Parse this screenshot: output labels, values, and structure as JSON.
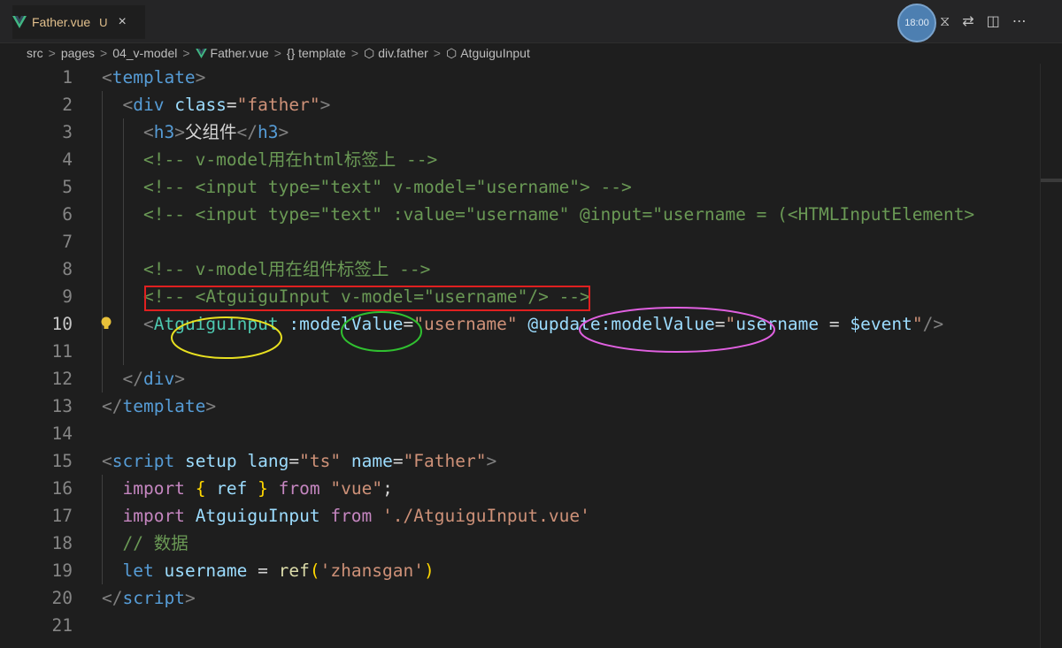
{
  "tab": {
    "label": "Father.vue",
    "status": "U",
    "close": "×"
  },
  "timer": {
    "label": "18:00"
  },
  "breadcrumb": [
    "src",
    "pages",
    "04_v-model",
    "Father.vue",
    "{} template",
    "div.father",
    "AtguiguInput"
  ],
  "editor": {
    "active_line": 10
  },
  "lines": [
    {
      "n": "1",
      "segs": [
        [
          "tag",
          "<"
        ],
        [
          "tn",
          "template"
        ],
        [
          "tag",
          ">"
        ]
      ]
    },
    {
      "n": "2",
      "segs": [
        [
          "txt",
          "  "
        ],
        [
          "tag",
          "<"
        ],
        [
          "tn",
          "div"
        ],
        [
          "txt",
          " "
        ],
        [
          "attr",
          "class"
        ],
        [
          "txt",
          "="
        ],
        [
          "str",
          "\"father\""
        ],
        [
          "tag",
          ">"
        ]
      ]
    },
    {
      "n": "3",
      "segs": [
        [
          "txt",
          "    "
        ],
        [
          "tag",
          "<"
        ],
        [
          "tn",
          "h3"
        ],
        [
          "tag",
          ">"
        ],
        [
          "txt",
          "父组件"
        ],
        [
          "tag",
          "</"
        ],
        [
          "tn",
          "h3"
        ],
        [
          "tag",
          ">"
        ]
      ]
    },
    {
      "n": "4",
      "segs": [
        [
          "txt",
          "    "
        ],
        [
          "com",
          "<!-- v-model用在html标签上 -->"
        ]
      ]
    },
    {
      "n": "5",
      "segs": [
        [
          "txt",
          "    "
        ],
        [
          "com",
          "<!-- <input type=\"text\" v-model=\"username\"> -->"
        ]
      ]
    },
    {
      "n": "6",
      "segs": [
        [
          "txt",
          "    "
        ],
        [
          "com",
          "<!-- <input type=\"text\" :value=\"username\" @input=\"username = (<HTMLInputElement>"
        ]
      ]
    },
    {
      "n": "7",
      "segs": []
    },
    {
      "n": "8",
      "segs": [
        [
          "txt",
          "    "
        ],
        [
          "com",
          "<!-- v-model用在组件标签上 -->"
        ]
      ]
    },
    {
      "n": "9",
      "segs": [
        [
          "txt",
          "    "
        ],
        [
          "com",
          "<!-- <AtguiguInput v-model=\"username\"/> -->"
        ]
      ]
    },
    {
      "n": "10",
      "segs": [
        [
          "txt",
          "    "
        ],
        [
          "tag",
          "<"
        ],
        [
          "comp",
          "AtguiguInput"
        ],
        [
          "txt",
          " "
        ],
        [
          "attr",
          ":modelValue"
        ],
        [
          "txt",
          "="
        ],
        [
          "str",
          "\"username\""
        ],
        [
          "txt",
          " "
        ],
        [
          "attr",
          "@update:modelValue"
        ],
        [
          "txt",
          "="
        ],
        [
          "str",
          "\""
        ],
        [
          "attr",
          "username"
        ],
        [
          "txt",
          " = "
        ],
        [
          "attr",
          "$event"
        ],
        [
          "str",
          "\""
        ],
        [
          "tag",
          "/>"
        ]
      ]
    },
    {
      "n": "11",
      "segs": []
    },
    {
      "n": "12",
      "segs": [
        [
          "txt",
          "  "
        ],
        [
          "tag",
          "</"
        ],
        [
          "tn",
          "div"
        ],
        [
          "tag",
          ">"
        ]
      ]
    },
    {
      "n": "13",
      "segs": [
        [
          "tag",
          "</"
        ],
        [
          "tn",
          "template"
        ],
        [
          "tag",
          ">"
        ]
      ]
    },
    {
      "n": "14",
      "segs": []
    },
    {
      "n": "15",
      "segs": [
        [
          "tag",
          "<"
        ],
        [
          "tn",
          "script"
        ],
        [
          "txt",
          " "
        ],
        [
          "attr",
          "setup"
        ],
        [
          "txt",
          " "
        ],
        [
          "attr",
          "lang"
        ],
        [
          "txt",
          "="
        ],
        [
          "str",
          "\"ts\""
        ],
        [
          "txt",
          " "
        ],
        [
          "attr",
          "name"
        ],
        [
          "txt",
          "="
        ],
        [
          "str",
          "\"Father\""
        ],
        [
          "tag",
          ">"
        ]
      ]
    },
    {
      "n": "16",
      "segs": [
        [
          "txt",
          "  "
        ],
        [
          "kw",
          "import"
        ],
        [
          "txt",
          " "
        ],
        [
          "br",
          "{"
        ],
        [
          "txt",
          " "
        ],
        [
          "attr",
          "ref"
        ],
        [
          "txt",
          " "
        ],
        [
          "br",
          "}"
        ],
        [
          "txt",
          " "
        ],
        [
          "kw",
          "from"
        ],
        [
          "txt",
          " "
        ],
        [
          "str",
          "\"vue\""
        ],
        [
          "txt",
          ";"
        ]
      ]
    },
    {
      "n": "17",
      "segs": [
        [
          "txt",
          "  "
        ],
        [
          "kw",
          "import"
        ],
        [
          "txt",
          " "
        ],
        [
          "attr",
          "AtguiguInput"
        ],
        [
          "txt",
          " "
        ],
        [
          "kw",
          "from"
        ],
        [
          "txt",
          " "
        ],
        [
          "str",
          "'./AtguiguInput.vue'"
        ]
      ]
    },
    {
      "n": "18",
      "segs": [
        [
          "txt",
          "  "
        ],
        [
          "com",
          "// 数据"
        ]
      ]
    },
    {
      "n": "19",
      "segs": [
        [
          "txt",
          "  "
        ],
        [
          "decl",
          "let"
        ],
        [
          "txt",
          " "
        ],
        [
          "attr",
          "username"
        ],
        [
          "txt",
          " = "
        ],
        [
          "fn",
          "ref"
        ],
        [
          "br",
          "("
        ],
        [
          "str",
          "'zhansgan'"
        ],
        [
          "br",
          ")"
        ]
      ]
    },
    {
      "n": "20",
      "segs": [
        [
          "tag",
          "</"
        ],
        [
          "tn",
          "script"
        ],
        [
          "tag",
          ">"
        ]
      ]
    },
    {
      "n": "21",
      "segs": []
    }
  ]
}
